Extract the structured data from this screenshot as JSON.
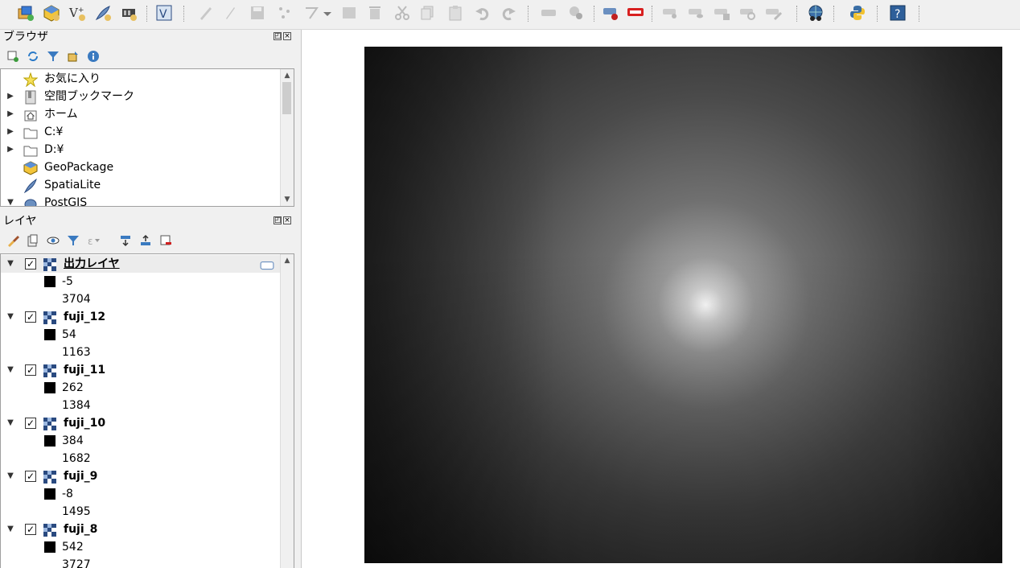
{
  "browser_panel": {
    "title": "ブラウザ",
    "items": [
      {
        "label": "お気に入り",
        "icon": "star-icon",
        "expandable": false
      },
      {
        "label": "空間ブックマーク",
        "icon": "bookmark-icon",
        "expandable": true
      },
      {
        "label": "ホーム",
        "icon": "home-folder-icon",
        "expandable": true
      },
      {
        "label": "C:¥",
        "icon": "folder-icon",
        "expandable": true
      },
      {
        "label": "D:¥",
        "icon": "folder-icon",
        "expandable": true
      },
      {
        "label": "GeoPackage",
        "icon": "geopackage-icon",
        "expandable": false
      },
      {
        "label": "SpatiaLite",
        "icon": "spatialite-feather-icon",
        "expandable": false
      },
      {
        "label": "PostGIS",
        "icon": "postgis-elephant-icon",
        "expandable": true
      }
    ]
  },
  "layers_panel": {
    "title": "レイヤ",
    "layers": [
      {
        "name": "出力レイヤ",
        "min": "-5",
        "max": "3704",
        "checked": true,
        "active": true
      },
      {
        "name": "fuji_12",
        "min": "54",
        "max": "1163",
        "checked": true,
        "active": false
      },
      {
        "name": "fuji_11",
        "min": "262",
        "max": "1384",
        "checked": true,
        "active": false
      },
      {
        "name": "fuji_10",
        "min": "384",
        "max": "1682",
        "checked": true,
        "active": false
      },
      {
        "name": "fuji_9",
        "min": "-8",
        "max": "1495",
        "checked": true,
        "active": false
      },
      {
        "name": "fuji_8",
        "min": "542",
        "max": "3727",
        "checked": true,
        "active": false
      }
    ]
  },
  "colors": {
    "checkmark": "#000000",
    "swatch": "#000000",
    "panel_bg": "#f0f0f0",
    "tree_bg": "#ffffff"
  }
}
